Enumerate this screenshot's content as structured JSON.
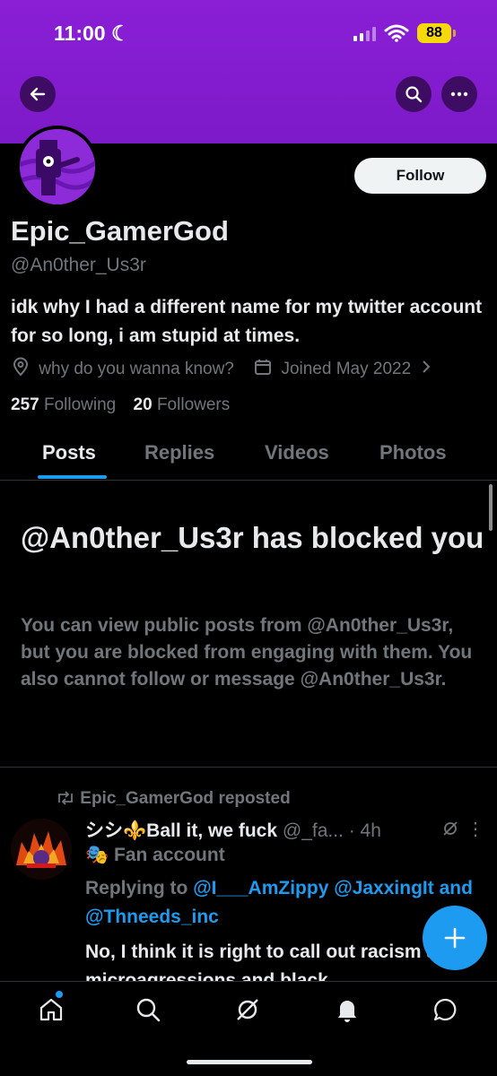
{
  "status_bar": {
    "time": "11:00",
    "battery": "88"
  },
  "profile": {
    "display_name": "Epic_GamerGod",
    "handle": "@An0ther_Us3r",
    "bio": "idk why I had a different name for my twitter account for so long, i am stupid at times.",
    "location": "why do you wanna know?",
    "joined": "Joined May 2022",
    "following_count": "257",
    "following_label": "Following",
    "followers_count": "20",
    "followers_label": "Followers",
    "follow_button": "Follow"
  },
  "tabs": [
    {
      "label": "Posts",
      "active": true
    },
    {
      "label": "Replies",
      "active": false
    },
    {
      "label": "Videos",
      "active": false
    },
    {
      "label": "Photos",
      "active": false
    }
  ],
  "blocked_notice": {
    "title": "@An0ther_Us3r has blocked you",
    "body": "You can view public posts from @An0ther_Us3r, but you are blocked from engaging with them. You also cannot follow or message @An0ther_Us3r."
  },
  "tweet": {
    "repost_label": "Epic_GamerGod reposted",
    "author_name": "シシ⚜️Ball it, we fuck",
    "author_handle": "@_fa...",
    "time": "· 4h",
    "fan_label": "Fan account",
    "replying_prefix": "Replying to",
    "mention_1": "@I___AmZippy",
    "mention_2": "@JaxxingIt",
    "and_word": "and",
    "mention_3": "@Thneeds_inc",
    "text": "No, I think it is right to call out racism and microagressions and black"
  },
  "icons": {
    "back": "arrow-left-icon",
    "search": "search-icon",
    "more": "more-icon",
    "location": "location-pin-icon",
    "calendar": "calendar-icon",
    "repost": "repost-icon",
    "fab": "plus-icon",
    "nav": [
      "home-icon",
      "search-icon",
      "grok-icon",
      "bell-icon",
      "message-icon"
    ]
  },
  "colors": {
    "banner": "#8a1fd6",
    "accent": "#1d9bf0",
    "background": "#000000"
  }
}
